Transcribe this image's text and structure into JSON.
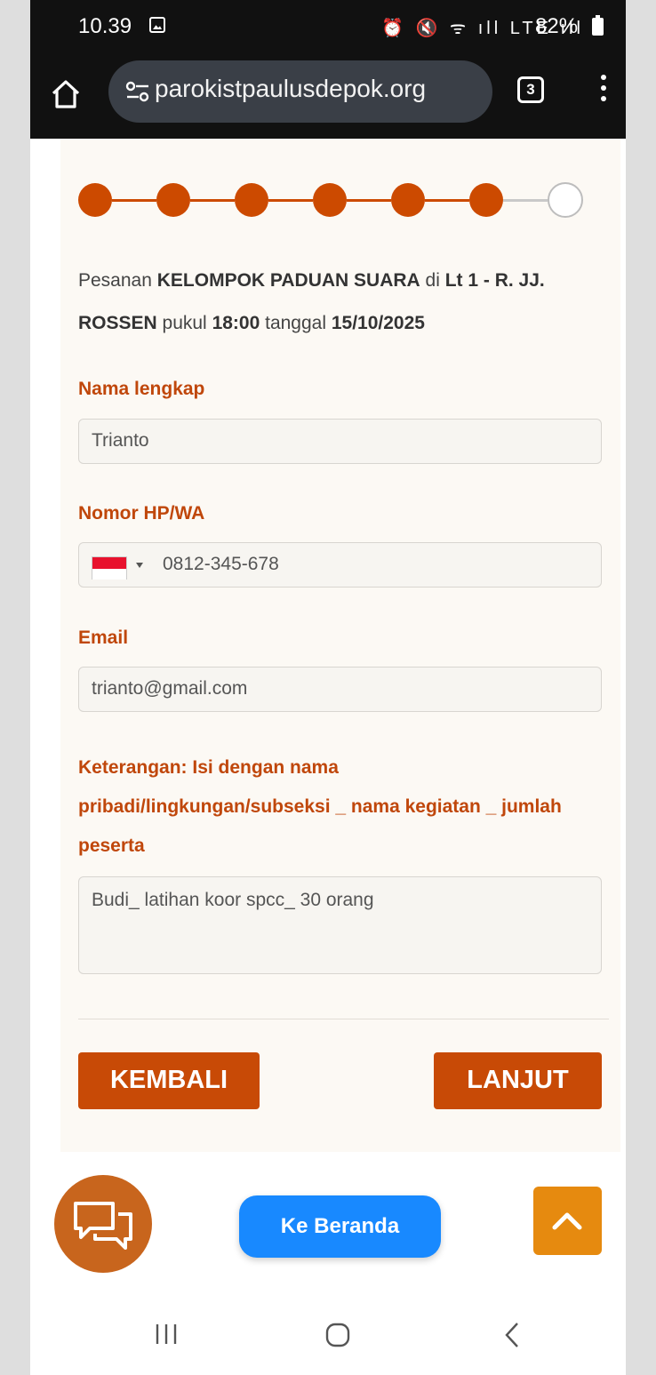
{
  "status_bar": {
    "time": "10.39",
    "status_icons": "⏰ 🔇 ᯤ ıll LTE ıll",
    "battery": "82%"
  },
  "browser": {
    "url": "parokistpaulusdepok.org",
    "tab_count": "3"
  },
  "booking": {
    "steps_total": 7,
    "steps_completed": 6,
    "summary": {
      "prefix": "Pesanan ",
      "group": "KELOMPOK PADUAN SUARA",
      "at": " di ",
      "room": "Lt 1 - R. JJ. ROSSEN",
      "time_label": " pukul ",
      "time": "18:00",
      "date_label": " tanggal ",
      "date": "15/10/2025"
    }
  },
  "form": {
    "name_label": "Nama lengkap",
    "name_value": "Trianto",
    "phone_label": "Nomor HP/WA",
    "phone_value": "0812-345-678",
    "email_label": "Email",
    "email_value": "trianto@gmail.com",
    "notes_label": "Keterangan: Isi dengan nama pribadi/lingkungan/subseksi _ nama kegiatan _ jumlah peserta",
    "notes_value": "Budi_ latihan koor spcc_ 30 orang"
  },
  "actions": {
    "back_label": "KEMBALI",
    "next_label": "LANJUT",
    "home_label": "Ke Beranda"
  },
  "colors": {
    "accent": "#cc4a00",
    "label": "#c0470b",
    "home_button": "#1889ff",
    "scroll_top": "#e68a0f",
    "chat": "#c8651d"
  }
}
